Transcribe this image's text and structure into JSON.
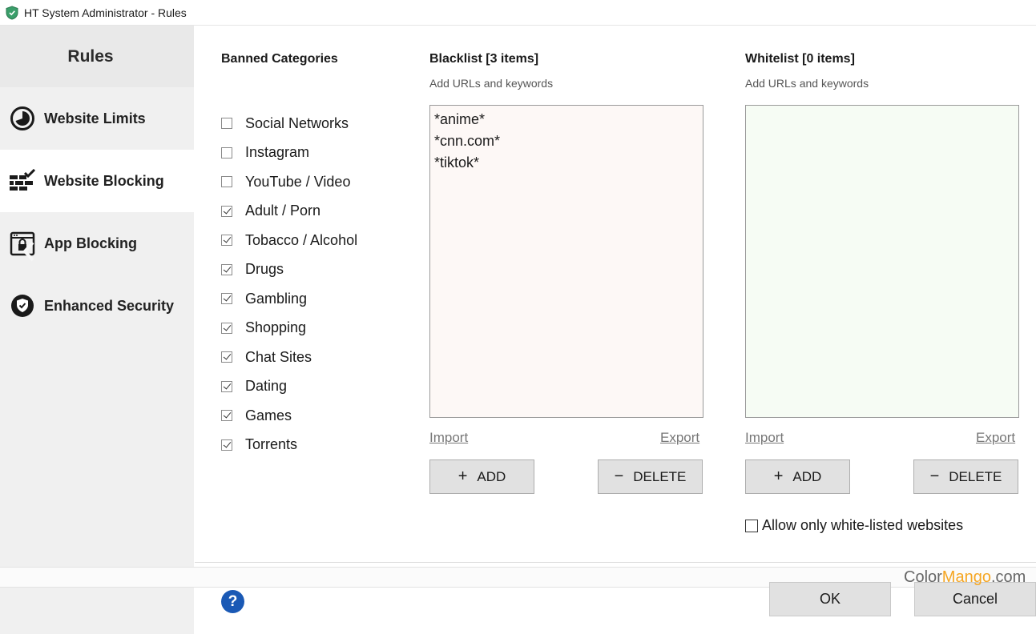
{
  "window": {
    "title": "HT System Administrator - Rules"
  },
  "sidebar": {
    "header": "Rules",
    "items": [
      {
        "label": "Website Limits",
        "icon": "clock-icon",
        "active": false
      },
      {
        "label": "Website Blocking",
        "icon": "blocked-wall-icon",
        "active": true
      },
      {
        "label": "App Blocking",
        "icon": "app-lock-icon",
        "active": false
      },
      {
        "label": "Enhanced Security",
        "icon": "shield-check-icon",
        "active": false
      }
    ]
  },
  "categories": {
    "title": "Banned Categories",
    "items": [
      {
        "label": "Social Networks",
        "checked": false
      },
      {
        "label": "Instagram",
        "checked": false
      },
      {
        "label": "YouTube / Video",
        "checked": false
      },
      {
        "label": "Adult / Porn",
        "checked": true
      },
      {
        "label": "Tobacco / Alcohol",
        "checked": true
      },
      {
        "label": "Drugs",
        "checked": true
      },
      {
        "label": "Gambling",
        "checked": true
      },
      {
        "label": "Shopping",
        "checked": true
      },
      {
        "label": "Chat Sites",
        "checked": true
      },
      {
        "label": "Dating",
        "checked": true
      },
      {
        "label": "Games",
        "checked": true
      },
      {
        "label": "Torrents",
        "checked": true
      }
    ]
  },
  "blacklist": {
    "title": "Blacklist [3 items]",
    "subtitle": "Add URLs and keywords",
    "items": [
      "*anime*",
      "*cnn.com*",
      "*tiktok*"
    ],
    "import_label": "Import",
    "export_label": "Export",
    "add_label": "ADD",
    "delete_label": "DELETE",
    "bg_color": "#fdf8f6"
  },
  "whitelist": {
    "title": "Whitelist [0 items]",
    "subtitle": "Add URLs and keywords",
    "items": [],
    "import_label": "Import",
    "export_label": "Export",
    "add_label": "ADD",
    "delete_label": "DELETE",
    "bg_color": "#f6fcf4"
  },
  "allow_only_whitelisted": {
    "label": "Allow only white-listed websites",
    "checked": false
  },
  "footer": {
    "help": "?",
    "ok_label": "OK",
    "cancel_label": "Cancel"
  },
  "watermark": {
    "part1": "Color",
    "part2": "Mango",
    "part3": ".com"
  }
}
